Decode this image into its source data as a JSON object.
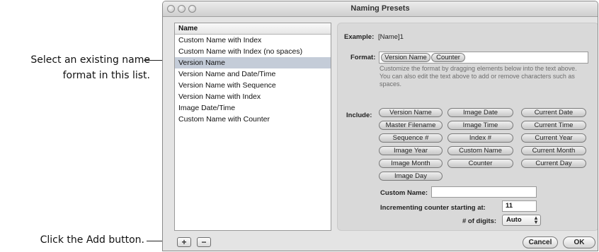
{
  "callouts": {
    "select_line1": "Select an existing name",
    "select_line2": "format in this list.",
    "add": "Click the Add button."
  },
  "window": {
    "title": "Naming Presets"
  },
  "list": {
    "header": "Name",
    "items": [
      "Custom Name with Index",
      "Custom Name with Index (no spaces)",
      "Version Name",
      "Version Name and Date/Time",
      "Version Name with Sequence",
      "Version Name with Index",
      "Image Date/Time",
      "Custom Name with Counter"
    ],
    "selected_index": 2
  },
  "example": {
    "label": "Example:",
    "value": "[Name]1"
  },
  "format": {
    "label": "Format:",
    "tokens": [
      "Version Name",
      "Counter"
    ],
    "help": "Customize the format by dragging elements below into the text above. You can also edit the text above to add or remove characters such as spaces."
  },
  "include": {
    "label": "Include:",
    "tokens": [
      [
        "Version Name",
        "Image Date",
        "Current Date"
      ],
      [
        "Master Filename",
        "Image Time",
        "Current Time"
      ],
      [
        "Sequence #",
        "Index #",
        "Current Year"
      ],
      [
        "Image Year",
        "Custom Name",
        "Current Month"
      ],
      [
        "Image Month",
        "Counter",
        "Current Day"
      ],
      [
        "Image Day"
      ]
    ]
  },
  "custom_name": {
    "label": "Custom Name:",
    "value": ""
  },
  "counter": {
    "label": "Incrementing counter starting at:",
    "value": "11"
  },
  "digits": {
    "label": "# of digits:",
    "value": "Auto"
  },
  "buttons": {
    "add": "+",
    "remove": "−",
    "cancel": "Cancel",
    "ok": "OK"
  }
}
